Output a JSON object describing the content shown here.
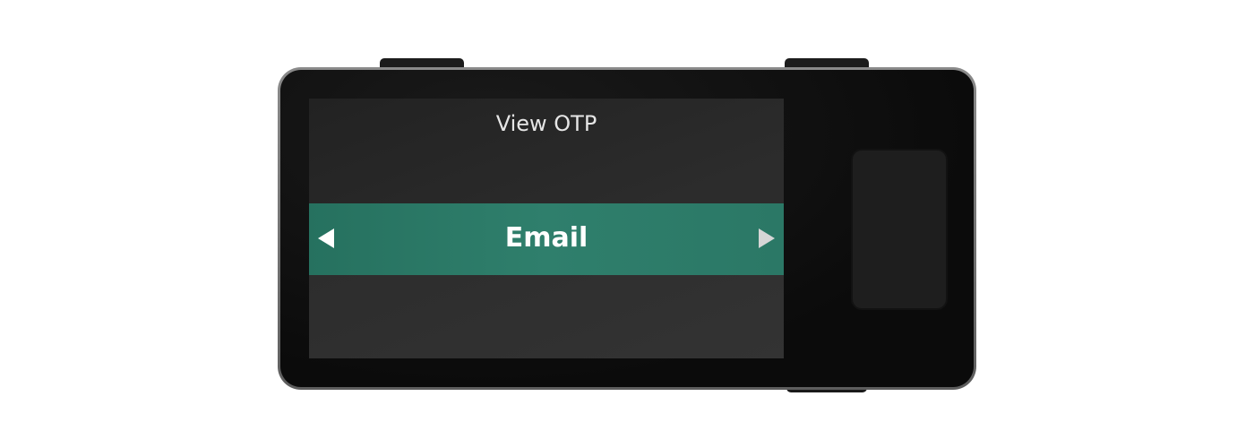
{
  "screen": {
    "title": "View OTP",
    "selector": {
      "value": "Email",
      "prev_icon": "triangle-left-icon",
      "next_icon": "triangle-right-icon"
    }
  },
  "colors": {
    "selector_bg": "#2f7f6c",
    "screen_bg": "#262626",
    "device_body": "#0b0b0b",
    "device_bezel": "#6e6e6e",
    "title_text": "#e6e6e6",
    "selector_text": "#ffffff"
  }
}
